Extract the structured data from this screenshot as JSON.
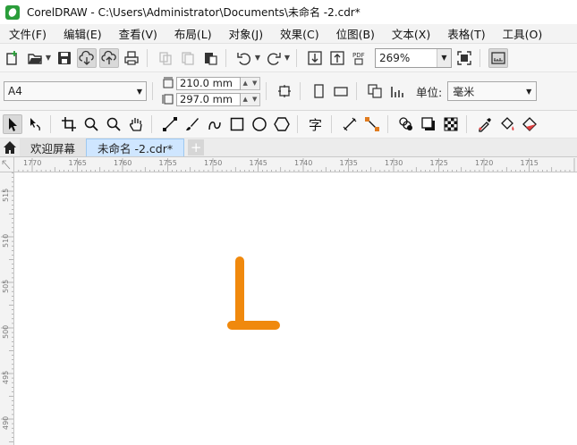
{
  "window": {
    "title": "CorelDRAW - C:\\Users\\Administrator\\Documents\\未命名 -2.cdr*"
  },
  "menu": {
    "items": [
      "文件(F)",
      "编辑(E)",
      "查看(V)",
      "布局(L)",
      "对象(J)",
      "效果(C)",
      "位图(B)",
      "文本(X)",
      "表格(T)",
      "工具(O)"
    ]
  },
  "standard_toolbar": {
    "zoom_value": "269%",
    "pdf_label": "PDF"
  },
  "property_bar": {
    "page_size": "A4",
    "width": "210.0 mm",
    "height": "297.0 mm",
    "unit_label": "单位:",
    "unit_value": "毫米"
  },
  "tabs": {
    "welcome": "欢迎屏幕",
    "document": "未命名 -2.cdr*"
  },
  "toolbox": {
    "text_tool_glyph": "字"
  },
  "rulers": {
    "horizontal": [
      "1770",
      "1765",
      "1760",
      "1755",
      "1750",
      "1745",
      "1740",
      "1735",
      "1730",
      "1725",
      "1720",
      "1715"
    ],
    "vertical": [
      "515",
      "510",
      "505",
      "500",
      "495",
      "490"
    ]
  },
  "colors": {
    "shape_stroke": "#F0890D",
    "accent_tab": "#CFE6FF"
  }
}
